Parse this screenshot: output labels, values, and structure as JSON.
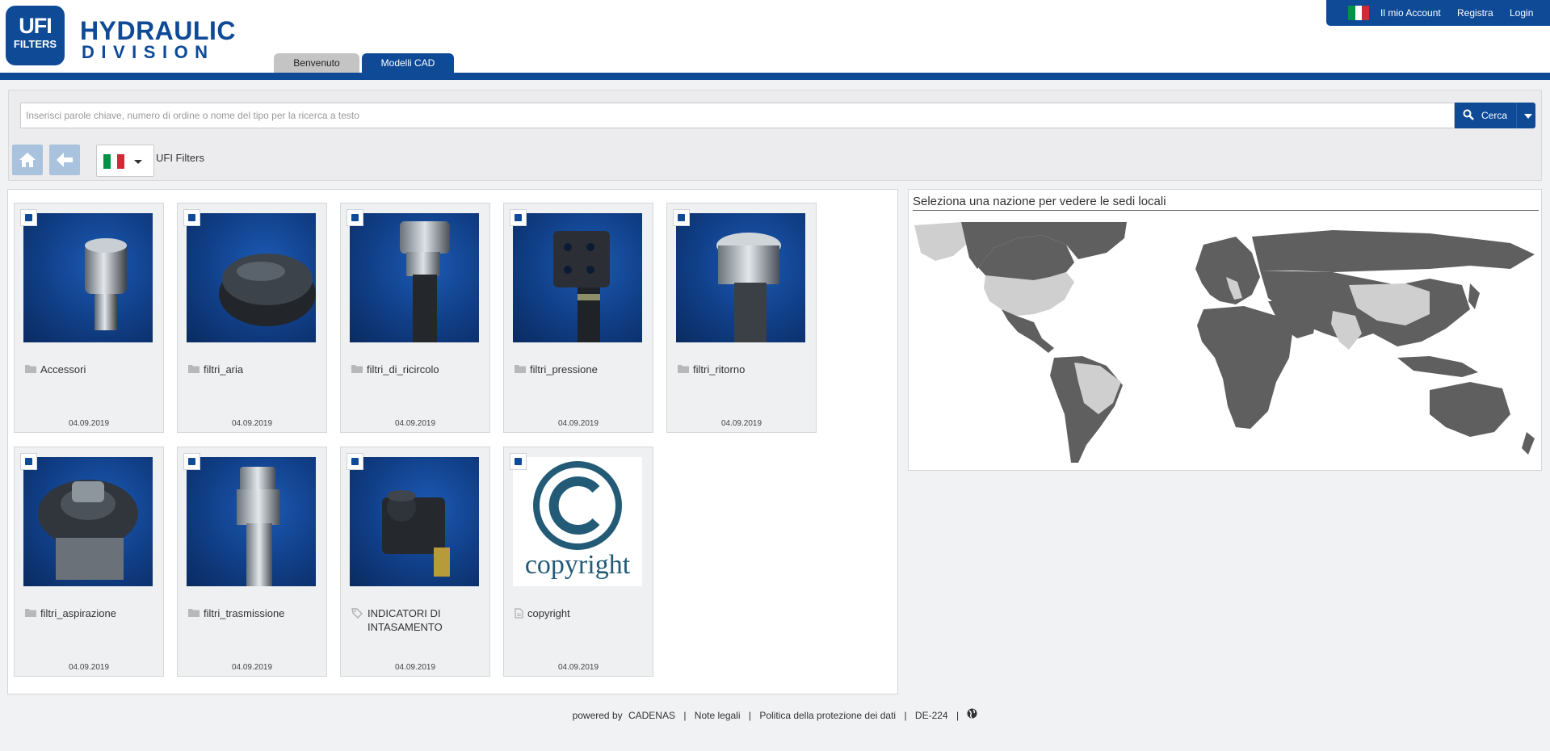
{
  "brand": {
    "mark_line1": "UFI",
    "mark_line2": "FILTERS",
    "name_line1": "HYDRAULIC",
    "name_line2": "DIVISION",
    "color": "#0e4a96"
  },
  "tabs": [
    {
      "label": "Benvenuto",
      "active": false
    },
    {
      "label": "Modelli CAD",
      "active": true
    }
  ],
  "account": {
    "flag": "italy-flag",
    "my_account": "Il mio Account",
    "register": "Registra",
    "login": "Login"
  },
  "search": {
    "placeholder": "Inserisci parole chiave, numero di ordine o nome del tipo per la ricerca a testo",
    "value": "",
    "button": "Cerca"
  },
  "navigation": {
    "language": "italy-flag",
    "breadcrumb": "UFI Filters"
  },
  "catalog": {
    "items": [
      {
        "name": "Accessori",
        "date": "04.09.2019",
        "icon": "folder-icon"
      },
      {
        "name": "filtri_aria",
        "date": "04.09.2019",
        "icon": "folder-icon"
      },
      {
        "name": "filtri_di_ricircolo",
        "date": "04.09.2019",
        "icon": "folder-icon"
      },
      {
        "name": "filtri_pressione",
        "date": "04.09.2019",
        "icon": "folder-icon"
      },
      {
        "name": "filtri_ritorno",
        "date": "04.09.2019",
        "icon": "folder-icon"
      },
      {
        "name": "filtri_aspirazione",
        "date": "04.09.2019",
        "icon": "folder-icon"
      },
      {
        "name": "filtri_trasmissione",
        "date": "04.09.2019",
        "icon": "folder-icon"
      },
      {
        "name": "INDICATORI DI INTASAMENTO",
        "date": "04.09.2019",
        "icon": "tags-icon"
      },
      {
        "name": "copyright",
        "date": "04.09.2019",
        "icon": "document-icon",
        "image_text": "copyright"
      }
    ]
  },
  "map": {
    "title": "Seleziona una nazione per vedere le sedi locali",
    "land_color": "#5f5f5f",
    "highlight_color": "#cfcfcf"
  },
  "footer": {
    "powered_by": "powered by",
    "cadenas": "CADENAS",
    "legal": "Note legali",
    "privacy": "Politica della protezione dei dati",
    "server": "DE-224"
  }
}
